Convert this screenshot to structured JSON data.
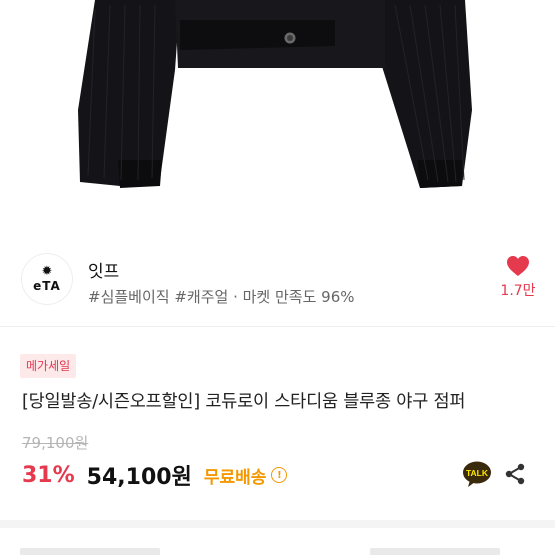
{
  "shop": {
    "logo_text": "eTA",
    "name": "잇프",
    "tags": "#심플베이직 #캐주얼 · 마켓 만족도 96%",
    "likes": "1.7만"
  },
  "product": {
    "badge": "메가세일",
    "title": "[당일발송/시즌오프할인] 코듀로이 스타디움 블루종 야구 점퍼",
    "original_price": "79,100원",
    "discount": "31%",
    "price": "54,100원",
    "shipping": "무료배송"
  },
  "actions": {
    "talk_label": "TALK"
  },
  "colors": {
    "accent": "#e5394e",
    "shipping": "#f39800",
    "talk_bg": "#3a2a0c",
    "talk_yellow": "#fee500"
  }
}
